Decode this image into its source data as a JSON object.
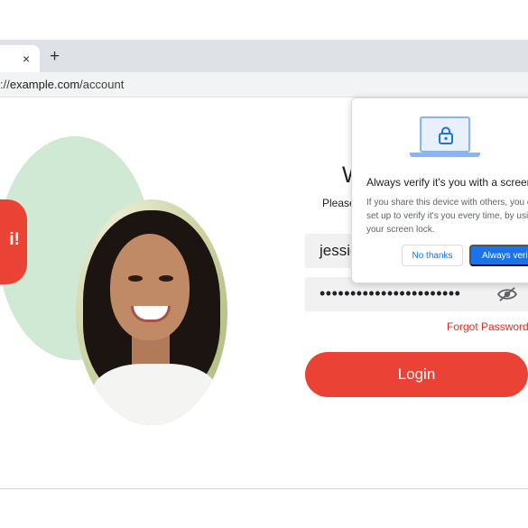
{
  "browser": {
    "tab_close_glyph": "×",
    "new_tab_glyph": "+",
    "url_prefix": "://",
    "url_host": "example.com",
    "url_path": "/account"
  },
  "hero": {
    "greeting_fragment": "i!"
  },
  "login": {
    "title_fragment": "W",
    "subtitle_fragment": "Please",
    "username_value": "jessic",
    "password_mask": "•••••••••••••••••••••••",
    "forgot_password": "Forgot Password?",
    "login_button": "Login"
  },
  "popup": {
    "title": "Always verify it's you with a screen lo",
    "body_lines": [
      "If you share this device with others, you c",
      "set up to verify it's you every time, by usin",
      "your screen lock."
    ],
    "no_thanks": "No thanks",
    "always_verify": "Always verify"
  },
  "colors": {
    "accent_red": "#ea4335",
    "accent_blue": "#1a73e8",
    "blob_green": "#cfe9d5",
    "field_gray": "#f1f1f1"
  },
  "icons": {
    "tab_close": "close-icon",
    "new_tab": "plus-icon",
    "password_toggle": "eye-off-icon",
    "popup_lock": "lock-icon"
  }
}
